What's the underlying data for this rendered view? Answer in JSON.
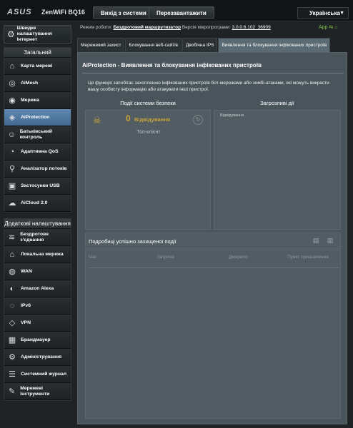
{
  "header": {
    "logo": "ASUS",
    "model": "ZenWiFi BQ16",
    "logout_label": "Вихід з системи",
    "reboot_label": "Перезавантажити",
    "language": "Українська"
  },
  "status": {
    "mode_label": "Режим роботи:",
    "mode_value": "Бездротовий маршрутизатор",
    "fw_label": "Версія мікропрограми:",
    "fw_value": "3.0.0.6.102_36909",
    "app_label": "App"
  },
  "sidebar": {
    "qis_label": "Швидке налаштування Інтернет",
    "general_header": "Загальний",
    "general_items": [
      {
        "label": "Карта мережі",
        "icon": "network-map-icon"
      },
      {
        "label": "AiMesh",
        "icon": "aimesh-icon"
      },
      {
        "label": "Мережа",
        "icon": "network-icon"
      },
      {
        "label": "AiProtection",
        "icon": "shield-icon"
      },
      {
        "label": "Батьківський контроль",
        "icon": "parental-control-icon"
      },
      {
        "label": "Адаптивна QoS",
        "icon": "qos-icon"
      },
      {
        "label": "Аналізатор потоків",
        "icon": "traffic-analyzer-icon"
      },
      {
        "label": "Застосунки USB",
        "icon": "usb-icon"
      },
      {
        "label": "AiCloud 2.0",
        "icon": "cloud-icon"
      }
    ],
    "advanced_header": "Додаткові налаштування",
    "advanced_items": [
      {
        "label": "Бездротове з'єднання",
        "icon": "wireless-icon"
      },
      {
        "label": "Локальна мережа",
        "icon": "lan-icon"
      },
      {
        "label": "WAN",
        "icon": "wan-icon"
      },
      {
        "label": "Amazon Alexa",
        "icon": "alexa-icon"
      },
      {
        "label": "IPv6",
        "icon": "ipv6-icon"
      },
      {
        "label": "VPN",
        "icon": "vpn-icon"
      },
      {
        "label": "Брандмауер",
        "icon": "firewall-icon"
      },
      {
        "label": "Адміністрування",
        "icon": "admin-icon"
      },
      {
        "label": "Системний журнал",
        "icon": "log-icon"
      },
      {
        "label": "Мережеві інструменти",
        "icon": "tools-icon"
      }
    ]
  },
  "tabs": [
    "Мережевий захист",
    "Блокування веб-сайтів",
    "Двобічна IPS",
    "Виявлення та блокування інфікованих пристроїв"
  ],
  "main": {
    "title": "AiProtection - Виявлення та блокування інфікованих пристроїв",
    "description": "Ця функція запобігає захопленню інфікованих пристроїв бот-мережами або зомбі-атаками, які можуть викрасти вашу особисту інформацію або атакувати інші пристрої.",
    "events_header": "Події системи безпеки",
    "threats_header": "Загрозливі дії",
    "blocked_count": "0",
    "blocked_label": "Відвідування",
    "top_client": "Топ-клієнт",
    "detected_label": "Відвідування",
    "details_title": "Подробиці успішно захищеної події",
    "table_headers": [
      "Час",
      "Загроза",
      "Джерело",
      "Пункт призначення"
    ]
  }
}
